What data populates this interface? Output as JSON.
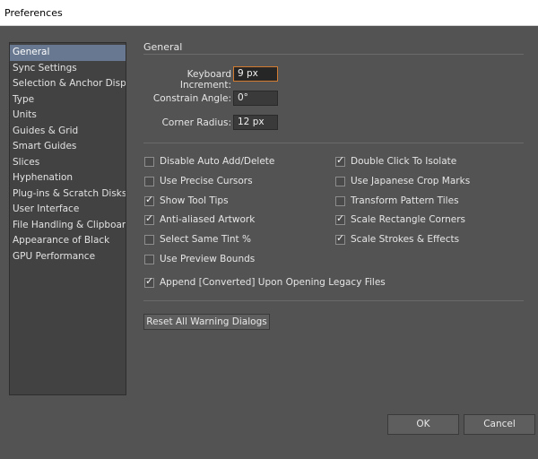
{
  "window": {
    "title": "Preferences"
  },
  "sidebar": {
    "items": [
      {
        "label": "General",
        "selected": true
      },
      {
        "label": "Sync Settings"
      },
      {
        "label": "Selection & Anchor Display"
      },
      {
        "label": "Type"
      },
      {
        "label": "Units"
      },
      {
        "label": "Guides & Grid"
      },
      {
        "label": "Smart Guides"
      },
      {
        "label": "Slices"
      },
      {
        "label": "Hyphenation"
      },
      {
        "label": "Plug-ins & Scratch Disks"
      },
      {
        "label": "User Interface"
      },
      {
        "label": "File Handling & Clipboard"
      },
      {
        "label": "Appearance of Black"
      },
      {
        "label": "GPU Performance"
      }
    ]
  },
  "general": {
    "title": "General",
    "keyboard_increment": {
      "label": "Keyboard Increment:",
      "value": "9 px"
    },
    "constrain_angle": {
      "label": "Constrain Angle:",
      "value": "0°"
    },
    "corner_radius": {
      "label": "Corner Radius:",
      "value": "12 px"
    },
    "options": {
      "disable_auto_add_delete": {
        "label": "Disable Auto Add/Delete",
        "checked": false
      },
      "use_precise_cursors": {
        "label": "Use Precise Cursors",
        "checked": false
      },
      "show_tool_tips": {
        "label": "Show Tool Tips",
        "checked": true
      },
      "anti_aliased_artwork": {
        "label": "Anti-aliased Artwork",
        "checked": true
      },
      "select_same_tint": {
        "label": "Select Same Tint %",
        "checked": false
      },
      "use_preview_bounds": {
        "label": "Use Preview Bounds",
        "checked": false
      },
      "append_converted": {
        "label": "Append [Converted] Upon Opening Legacy Files",
        "checked": true
      },
      "double_click_to_isolate": {
        "label": "Double Click To Isolate",
        "checked": true
      },
      "use_japanese_crop_marks": {
        "label": "Use Japanese Crop Marks",
        "checked": false
      },
      "transform_pattern_tiles": {
        "label": "Transform Pattern Tiles",
        "checked": false
      },
      "scale_rectangle_corners": {
        "label": "Scale Rectangle Corners",
        "checked": true
      },
      "scale_strokes_effects": {
        "label": "Scale Strokes & Effects",
        "checked": true
      }
    },
    "reset_warning_dialogs": "Reset All Warning Dialogs"
  },
  "buttons": {
    "ok": "OK",
    "cancel": "Cancel"
  }
}
